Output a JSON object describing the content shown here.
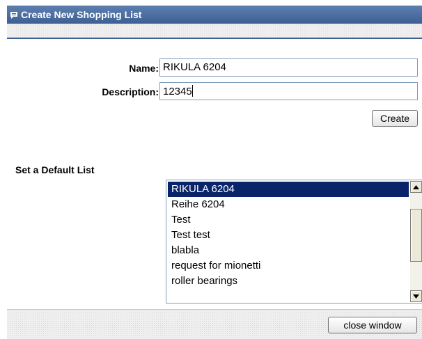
{
  "window": {
    "title": "Create New Shopping List",
    "title_icon": "chat-bubble-icon"
  },
  "form": {
    "name_label": "Name:",
    "name_value": "RIKULA 6204",
    "description_label": "Description:",
    "description_value": "12345",
    "create_button": "Create"
  },
  "default_list": {
    "heading": "Set a Default List",
    "items": [
      {
        "label": "RIKULA 6204",
        "selected": true
      },
      {
        "label": "Reihe 6204",
        "selected": false
      },
      {
        "label": "Test",
        "selected": false
      },
      {
        "label": "Test test",
        "selected": false
      },
      {
        "label": "blabla",
        "selected": false
      },
      {
        "label": "request for mionetti",
        "selected": false
      },
      {
        "label": "roller bearings",
        "selected": false
      }
    ]
  },
  "footer": {
    "close_button": "close window"
  },
  "colors": {
    "title_bar": "#4a6ba0",
    "selection": "#0a246a",
    "input_border": "#7f9db9"
  }
}
